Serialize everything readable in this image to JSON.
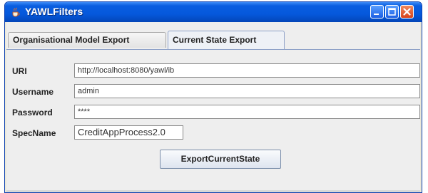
{
  "window": {
    "title": "YAWLFilters"
  },
  "tabs": [
    {
      "label": "Organisational Model Export"
    },
    {
      "label": "Current State Export"
    }
  ],
  "form": {
    "uri_label": "URI",
    "uri_value": "http://localhost:8080/yawl/ib",
    "username_label": "Username",
    "username_value": "admin",
    "password_label": "Password",
    "password_value": "****",
    "specname_label": "SpecName",
    "specname_value": "CreditAppProcess2.0"
  },
  "actions": {
    "export_label": "ExportCurrentState"
  },
  "colors": {
    "titlebar": "#0558dc",
    "close_button": "#d8431c",
    "active_tab": "#eef1f6"
  },
  "icons": [
    "java-cup-icon",
    "minimize-icon",
    "maximize-icon",
    "close-icon"
  ]
}
